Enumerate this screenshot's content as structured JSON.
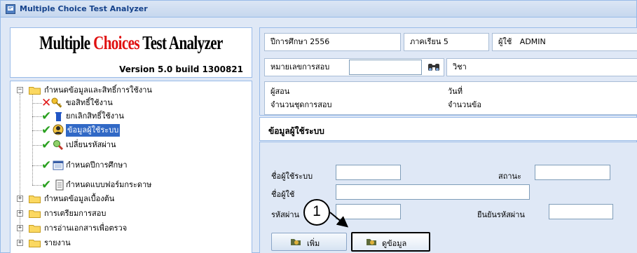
{
  "window": {
    "title": "Multiple Choice Test Analyzer",
    "icon": "app-icon"
  },
  "logo": {
    "word1": "Multiple ",
    "word2": "Choices",
    "word3": " Test Analyzer",
    "version": "Version 5.0  build 1300821"
  },
  "tree": {
    "root": "กำหนดข้อมูลและสิทธิ์การใช้งาน",
    "children": [
      "ขอสิทธิ์ใช้งาน",
      "ยกเลิกสิทธิ์ใช้งาน",
      "ข้อมูลผู้ใช้ระบบ",
      "เปลี่ยนรหัสผ่าน",
      "กำหนดปีการศึกษา",
      "กำหนดแบบฟอร์มกระดาษ"
    ],
    "groups": [
      "กำหนดข้อมูลเบื้องต้น",
      "การเตรียมการสอบ",
      "การอ่านเอกสารเพื่อตรวจ",
      "รายงาน"
    ]
  },
  "info": {
    "year_label": "ปีการศึกษา  2556",
    "term_label": "ภาคเรียน  5",
    "user_label": "ผู้ใช้",
    "user_value": "ADMIN",
    "exam_no_label": "หมายเลขการสอบ",
    "subject_label": "วิชา",
    "teacher_label": "ผู้สอน",
    "date_label": "วันที่",
    "sets_label": "จำนวนชุดการสอบ",
    "items_label": "จำนวนข้อ"
  },
  "section": {
    "title": "ข้อมูลผู้ใช้ระบบ"
  },
  "form": {
    "username_label": "ชื่อผู้ใช้ระบบ",
    "status_label": "สถานะ",
    "name_label": "ชื่อผู้ใช้",
    "password_label": "รหัสผ่าน",
    "confirm_label": "ยืนยันรหัสผ่าน",
    "add_button": "เพิ่ม",
    "view_button": "ดูข้อมูล"
  },
  "callout": {
    "number": "1"
  }
}
